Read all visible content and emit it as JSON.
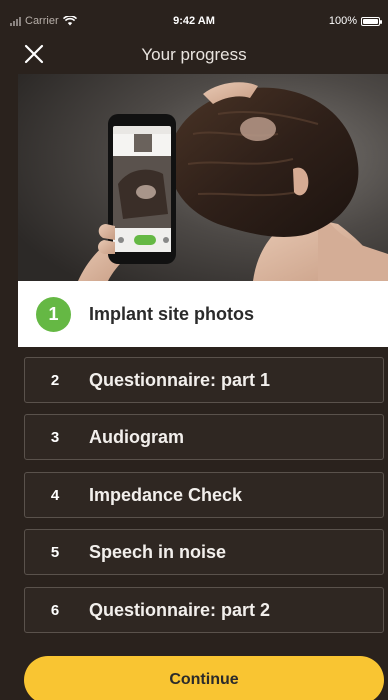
{
  "status_bar": {
    "carrier": "Carrier",
    "time": "9:42 AM",
    "battery": "100%"
  },
  "nav": {
    "title": "Your progress",
    "close_icon": "close-icon"
  },
  "hero": {
    "image": "photo of person photographing back of head with phone"
  },
  "active_step": {
    "number": "1",
    "label": "Implant site photos"
  },
  "steps": [
    {
      "number": "2",
      "label": "Questionnaire: part 1"
    },
    {
      "number": "3",
      "label": "Audiogram"
    },
    {
      "number": "4",
      "label": "Impedance Check"
    },
    {
      "number": "5",
      "label": "Speech in noise"
    },
    {
      "number": "6",
      "label": "Questionnaire: part 2"
    }
  ],
  "continue_label": "Continue",
  "colors": {
    "accent_yellow": "#f9c532",
    "active_green": "#65b844",
    "background": "#2a221d"
  }
}
